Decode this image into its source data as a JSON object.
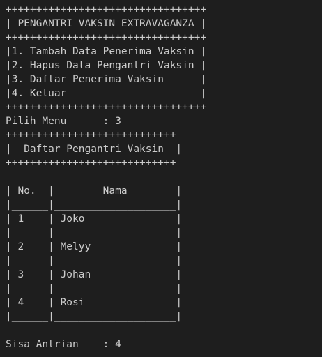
{
  "terminal": {
    "lines": [
      "+++++++++++++++++++++++++++++++++",
      "| PENGANTRI VAKSIN EXTRAVAGANZA |",
      "+++++++++++++++++++++++++++++++++",
      "|1. Tambah Data Penerima Vaksin |",
      "|2. Hapus Data Pengantri Vaksin |",
      "|3. Daftar Penerima Vaksin      |",
      "|4. Keluar                      |",
      "+++++++++++++++++++++++++++++++++",
      "Pilih Menu      : 3",
      "++++++++++++++++++++++++++++",
      "|  Daftar Pengantri Vaksin  |",
      "++++++++++++++++++++++++++++",
      "",
      " __________________________",
      "| No.  |        Nama        |",
      "|______|____________________|",
      "| 1    | Joko               |",
      "|______|____________________|",
      "| 2    | Melyy              |",
      "|______|____________________|",
      "| 3    | Johan              |",
      "|______|____________________|",
      "| 4    | Rosi               |",
      "|______|____________________|",
      "",
      "Sisa Antrian    : 4"
    ]
  }
}
